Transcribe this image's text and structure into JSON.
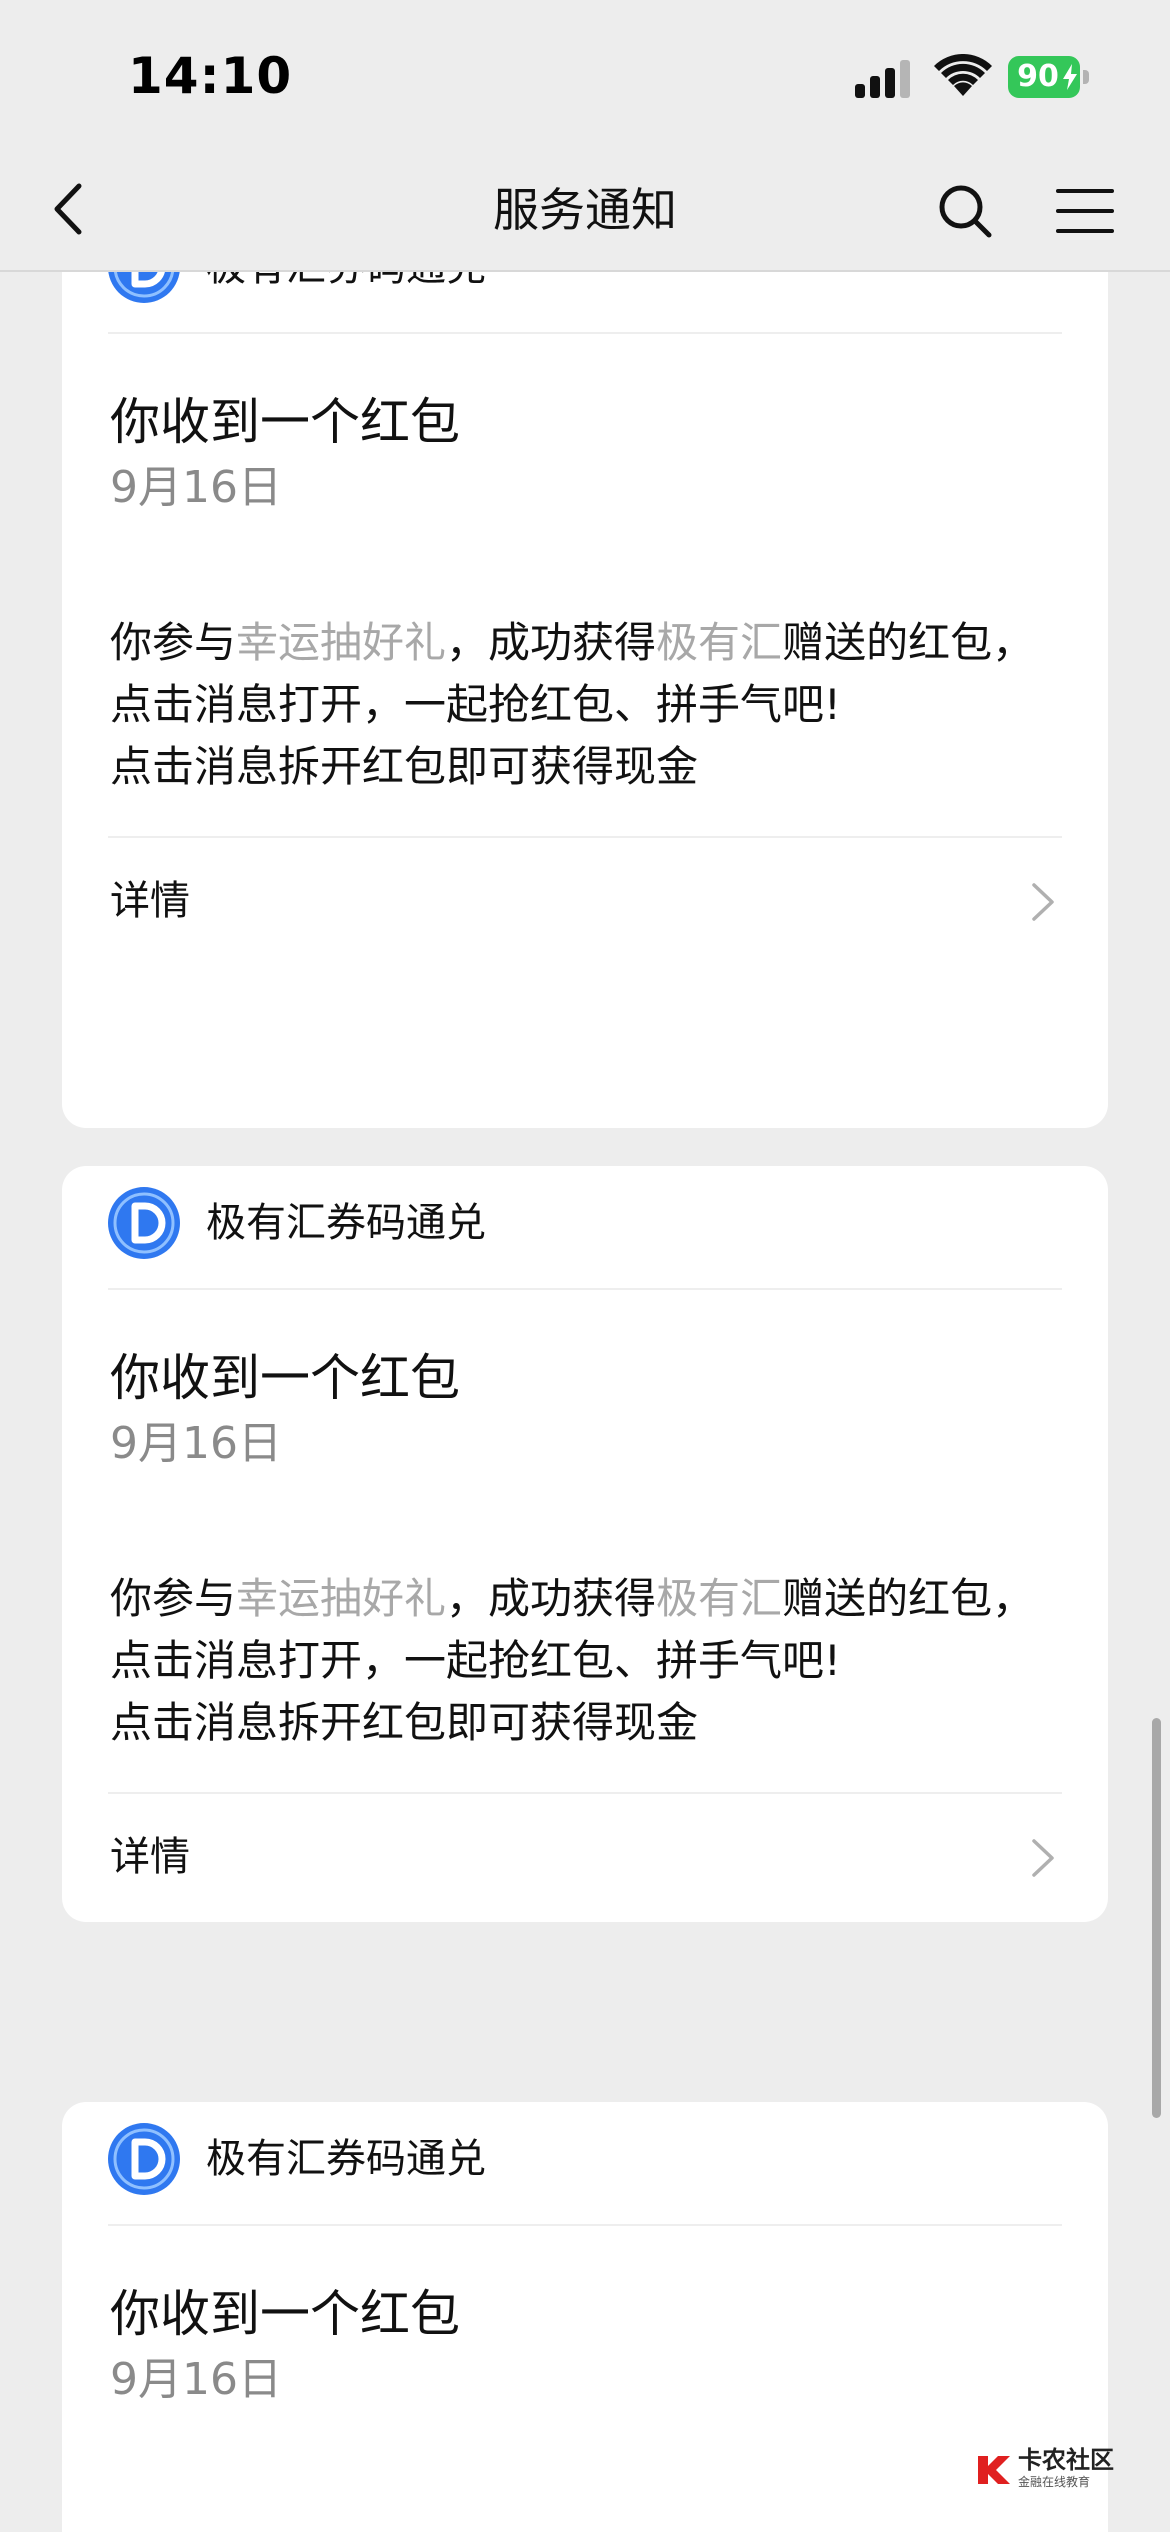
{
  "status_bar": {
    "time": "14:10",
    "battery_level": "90",
    "icons": [
      "signal-icon",
      "wifi-icon",
      "battery-charging-icon"
    ]
  },
  "nav": {
    "title": "服务通知",
    "icons": [
      "chevron-left-icon",
      "search-icon",
      "menu-icon"
    ]
  },
  "colors": {
    "background": "#ededed",
    "card": "#ffffff",
    "highlight_text": "#a8a8a8",
    "date_text": "#8a8a8a",
    "logo_blue": "#2f78f0",
    "battery_green": "#34c759"
  },
  "messages": [
    {
      "sender": "极有汇券码通兑",
      "title": "你收到一个红包",
      "date": "9月16日",
      "body_1": "你参与",
      "body_hl_1": "幸运抽好礼",
      "body_2": "，成功获得",
      "body_hl_2": "极有汇",
      "body_3": "赠送的红包，点击消息打开，一起抢红包、拼手气吧!",
      "body_line_2": "点击消息拆开红包即可获得现金",
      "detail_label": "详情"
    },
    {
      "sender": "极有汇券码通兑",
      "title": "你收到一个红包",
      "date": "9月16日",
      "body_1": "你参与",
      "body_hl_1": "幸运抽好礼",
      "body_2": "，成功获得",
      "body_hl_2": "极有汇",
      "body_3": "赠送的红包，点击消息打开，一起抢红包、拼手气吧!",
      "body_line_2": "点击消息拆开红包即可获得现金",
      "detail_label": "详情"
    },
    {
      "sender": "极有汇券码通兑",
      "title": "你收到一个红包",
      "date": "9月16日"
    }
  ],
  "watermark": {
    "title": "卡农社区",
    "subtitle": "金融在线教育"
  }
}
